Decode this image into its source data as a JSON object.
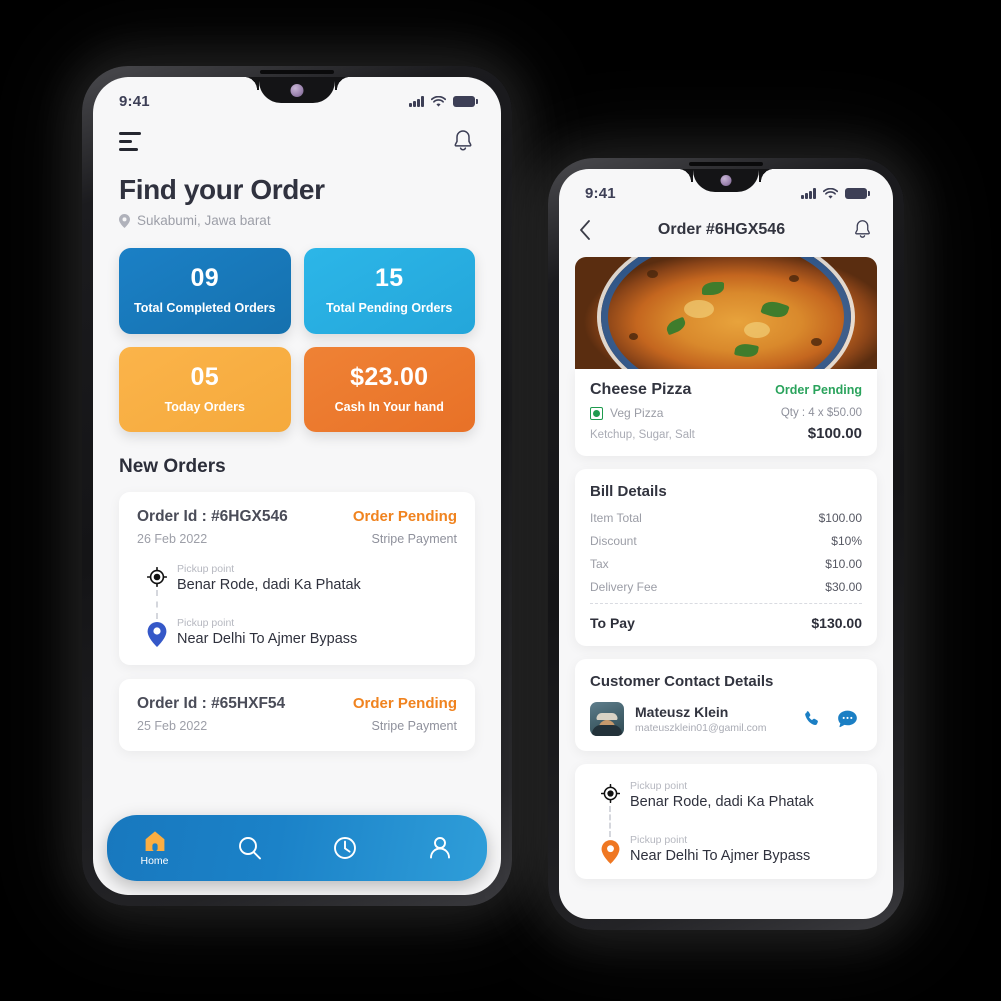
{
  "left_phone": {
    "status_bar": {
      "time": "9:41",
      "signal_icon": "signal-bars-icon",
      "wifi_icon": "wifi-icon",
      "battery_icon": "battery-icon"
    },
    "app_bar": {
      "menu_icon": "hamburger-menu-icon",
      "notification_icon": "bell-icon"
    },
    "title": "Find your Order",
    "location": {
      "icon": "location-pin-icon",
      "text": "Sukabumi, Jawa barat"
    },
    "stats": [
      {
        "value": "09",
        "label": "Total Completed Orders",
        "color": "#1878be"
      },
      {
        "value": "15",
        "label": "Total Pending Orders",
        "color": "#2cb6e8"
      },
      {
        "value": "05",
        "label": "Today Orders",
        "color": "#fbb44a"
      },
      {
        "value": "$23.00",
        "label": "Cash In Your hand",
        "color": "#ef8235"
      }
    ],
    "section_title": "New Orders",
    "orders": [
      {
        "id_label": "Order Id : #6HGX546",
        "status": "Order Pending",
        "date": "26 Feb 2022",
        "payment": "Stripe Payment",
        "pickup_label": "Pickup point",
        "pickup_value": "Benar Rode, dadi Ka Phatak",
        "drop_label": "Pickup point",
        "drop_value": "Near Delhi To Ajmer Bypass"
      },
      {
        "id_label": "Order Id : #65HXF54",
        "status": "Order Pending",
        "date": "25 Feb 2022",
        "payment": "Stripe Payment"
      }
    ],
    "bottom_nav": [
      {
        "icon": "home-icon",
        "label": "Home",
        "active": true
      },
      {
        "icon": "search-icon",
        "label": "",
        "active": false
      },
      {
        "icon": "clock-icon",
        "label": "",
        "active": false
      },
      {
        "icon": "profile-icon",
        "label": "",
        "active": false
      }
    ]
  },
  "right_phone": {
    "status_bar": {
      "time": "9:41",
      "signal_icon": "signal-bars-icon",
      "wifi_icon": "wifi-icon",
      "battery_icon": "battery-icon"
    },
    "app_bar": {
      "back_icon": "chevron-left-icon",
      "title": "Order #6HGX546",
      "notification_icon": "bell-icon"
    },
    "item": {
      "image_alt": "cheese-pizza-photo",
      "name": "Cheese Pizza",
      "status": "Order Pending",
      "veg_label": "Veg Pizza",
      "qty": "Qty : 4 x $50.00",
      "ingredients": "Ketchup, Sugar, Salt",
      "price": "$100.00"
    },
    "bill": {
      "title": "Bill Details",
      "lines": [
        {
          "key": "Item Total",
          "value": "$100.00"
        },
        {
          "key": "Discount",
          "value": "$10%"
        },
        {
          "key": "Tax",
          "value": "$10.00"
        },
        {
          "key": "Delivery Fee",
          "value": "$30.00"
        }
      ],
      "total_key": "To Pay",
      "total_value": "$130.00"
    },
    "customer": {
      "title": "Customer Contact Details",
      "name": "Mateusz Klein",
      "email": "mateuszklein01@gamil.com",
      "call_icon": "phone-icon",
      "chat_icon": "chat-bubble-icon"
    },
    "address": {
      "pickup_label": "Pickup point",
      "pickup_value": "Benar Rode, dadi Ka Phatak",
      "drop_label": "Pickup point",
      "drop_value": "Near Delhi To Ajmer Bypass"
    }
  }
}
